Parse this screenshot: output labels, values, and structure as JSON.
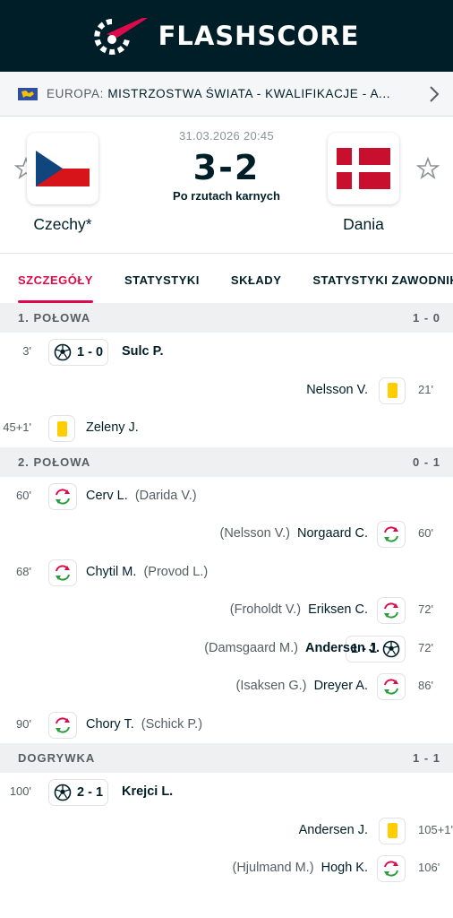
{
  "app": {
    "brand": "FLASHSCORE",
    "colors": {
      "topbar": "#001e28",
      "accent": "#dc0a4b",
      "card_yellow": "#ffcd00"
    }
  },
  "league": {
    "country": "EUROPA:",
    "name": "MISTRZOSTWA ŚWIATA - KWALIFIKACJE - A...",
    "icon": "europe-flag-icon"
  },
  "match": {
    "datetime": "31.03.2026 20:45",
    "score": "3-2",
    "status": "Po rzutach karnych",
    "home": {
      "name": "Czechy*"
    },
    "away": {
      "name": "Dania"
    }
  },
  "tabs": [
    "SZCZEGÓŁY",
    "STATYSTYKI",
    "SKŁADY",
    "STATYSTYKI ZAWODNIKÓW"
  ],
  "active_tab": "SZCZEGÓŁY",
  "sections": [
    {
      "title": "1. POŁOWA",
      "score": "1 - 0",
      "events": [
        {
          "side": "home",
          "type": "goal",
          "minute": "3'",
          "score": "1 - 0",
          "player": "Sulc P.",
          "assist": ""
        },
        {
          "side": "away",
          "type": "yellow",
          "minute": "21'",
          "player": "Nelsson V.",
          "assist": ""
        },
        {
          "side": "home",
          "type": "yellow",
          "minute": "45+1'",
          "player": "Zeleny J.",
          "assist": ""
        }
      ]
    },
    {
      "title": "2. POŁOWA",
      "score": "0 - 1",
      "events": [
        {
          "side": "home",
          "type": "sub",
          "minute": "60'",
          "player": "Cerv L.",
          "assist": "(Darida V.)"
        },
        {
          "side": "away",
          "type": "sub",
          "minute": "60'",
          "player": "Norgaard C.",
          "assist": "(Nelsson V.)"
        },
        {
          "side": "home",
          "type": "sub",
          "minute": "68'",
          "player": "Chytil M.",
          "assist": "(Provod L.)"
        },
        {
          "side": "away",
          "type": "sub",
          "minute": "72'",
          "player": "Eriksen C.",
          "assist": "(Froholdt V.)"
        },
        {
          "side": "away",
          "type": "goal",
          "minute": "72'",
          "score": "1 - 1",
          "player": "Andersen J.",
          "assist": "(Damsgaard M.)"
        },
        {
          "side": "away",
          "type": "sub",
          "minute": "86'",
          "player": "Dreyer A.",
          "assist": "(Isaksen G.)"
        },
        {
          "side": "home",
          "type": "sub",
          "minute": "90'",
          "player": "Chory T.",
          "assist": "(Schick P.)"
        }
      ]
    },
    {
      "title": "DOGRYWKA",
      "score": "1 - 1",
      "events": [
        {
          "side": "home",
          "type": "goal",
          "minute": "100'",
          "score": "2 - 1",
          "player": "Krejci L.",
          "assist": ""
        },
        {
          "side": "away",
          "type": "yellow",
          "minute": "105+1'",
          "player": "Andersen J.",
          "assist": ""
        },
        {
          "side": "away",
          "type": "sub",
          "minute": "106'",
          "player": "Hogh K.",
          "assist": "(Hjulmand M.)"
        }
      ]
    }
  ]
}
